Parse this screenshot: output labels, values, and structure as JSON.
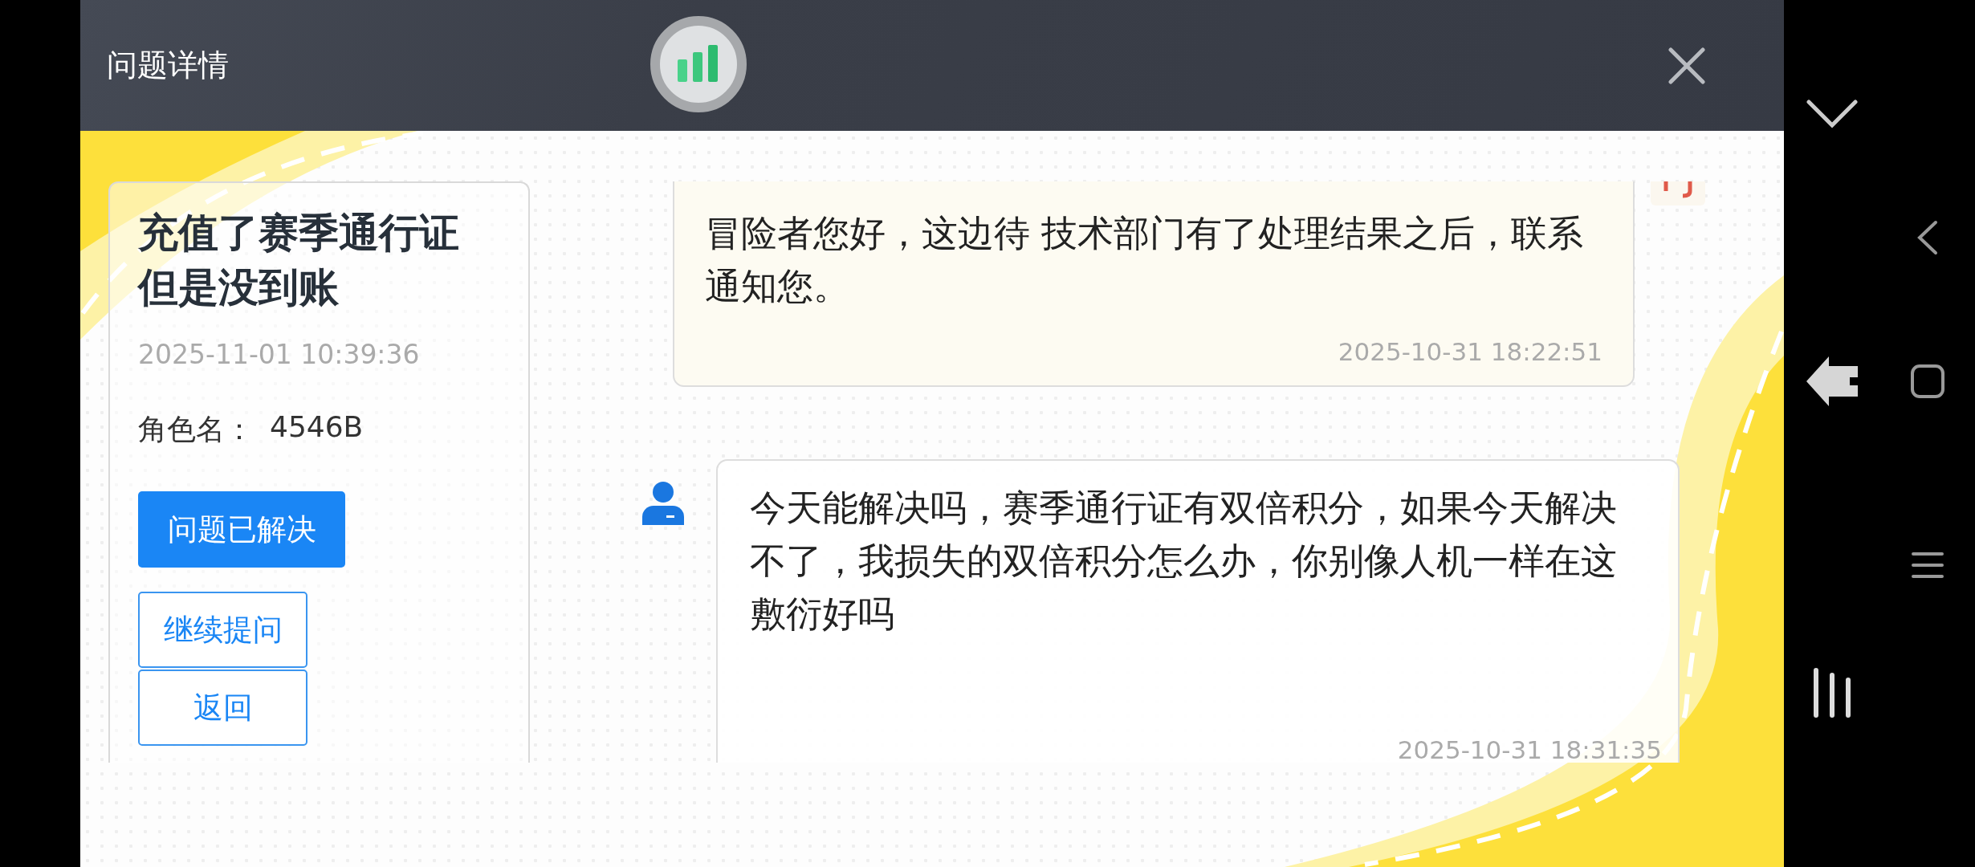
{
  "header": {
    "title": "问题详情"
  },
  "issue": {
    "title": "充值了赛季通行证但是没到账",
    "time": "2025-11-01 10:39:36",
    "role_label": "角色名：",
    "role_name": "4546B",
    "buttons": [
      {
        "label": "问题已解决",
        "kind": "primary"
      },
      {
        "label": "继续提问",
        "kind": "outline"
      },
      {
        "label": "返回",
        "kind": "outline"
      }
    ]
  },
  "messages": [
    {
      "kind": "agent",
      "text": "冒险者您好，这边待 技术部门有了处理结果之后，联系通知您。",
      "time": "2025-10-31 18:22:51"
    },
    {
      "kind": "user",
      "text": "今天能解决吗，赛季通行证有双倍积分，如果今天解决不了，我损失的双倍积分怎么办，你别像人机一样在这敷衍好吗",
      "time": "2025-10-31 18:31:35"
    }
  ]
}
